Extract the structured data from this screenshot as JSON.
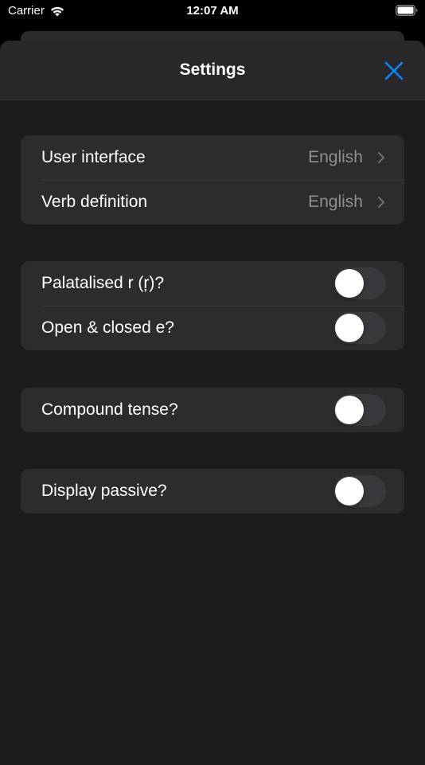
{
  "status_bar": {
    "carrier": "Carrier",
    "time": "12:07 AM",
    "wifi_icon": "wifi-icon",
    "battery_icon": "battery-icon"
  },
  "nav": {
    "title": "Settings",
    "close_icon": "close-icon",
    "accent_color": "#0a84ff"
  },
  "language_group": {
    "rows": [
      {
        "label": "User interface",
        "value": "English"
      },
      {
        "label": "Verb definition",
        "value": "English"
      }
    ]
  },
  "pronunciation_group": {
    "rows": [
      {
        "label": "Palatalised r (ŗ)?",
        "enabled": false
      },
      {
        "label": "Open & closed e?",
        "enabled": false
      }
    ]
  },
  "tense_group": {
    "rows": [
      {
        "label": "Compound tense?",
        "enabled": false
      }
    ]
  },
  "passive_group": {
    "rows": [
      {
        "label": "Display passive?",
        "enabled": false
      }
    ]
  }
}
